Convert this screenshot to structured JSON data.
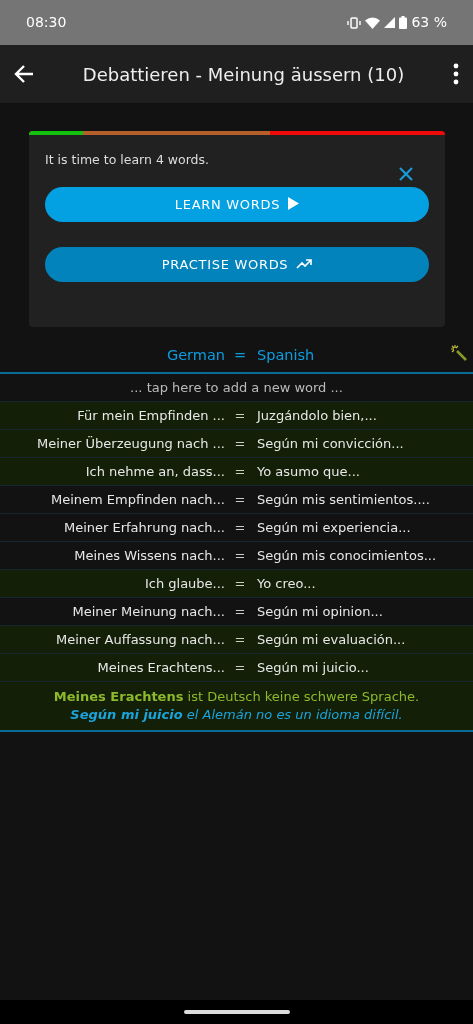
{
  "status_bar": {
    "time": "08:30",
    "battery": "63 %"
  },
  "app_bar": {
    "title": "Debattieren - Meinung äussern (10)"
  },
  "progress": {
    "color": "#f00a0a",
    "fills": [
      {
        "color": "#b5602a",
        "level": 0.58
      },
      {
        "color": "#13c10f",
        "level": 0.13
      }
    ]
  },
  "reminder": {
    "message": "It is time to learn 4 words.",
    "buttons": [
      {
        "label": "LEARN WORDS",
        "kind": "play"
      },
      {
        "label": "PRACTISE WORDS",
        "kind": "trend"
      }
    ]
  },
  "header": {
    "left": "German",
    "separator": "=",
    "right": "Spanish"
  },
  "add_hint": "... tap here to add a new word ...",
  "words": [
    {
      "left": "Für mein Empfinden ...",
      "sep": "=",
      "right": "Juzgándolo bien,...",
      "learned": true
    },
    {
      "left": "Meiner Überzeugung nach ...",
      "sep": "=",
      "right": "Según mi convicción...",
      "learned": true
    },
    {
      "left": "Ich nehme an, dass...",
      "sep": "=",
      "right": "Yo asumo que...",
      "learned": true
    },
    {
      "left": "Meinem Empfinden nach...",
      "sep": "=",
      "right": "Según mis sentimientos....",
      "learned": false
    },
    {
      "left": "Meiner Erfahrung nach...",
      "sep": "=",
      "right": "Según mi experiencia...",
      "learned": false
    },
    {
      "left": "Meines Wissens nach...",
      "sep": "=",
      "right": "Según mis conocimientos...",
      "learned": false
    },
    {
      "left": "Ich glaube...",
      "sep": "=",
      "right": "Yo creo...",
      "learned": true
    },
    {
      "left": "Meiner Meinung nach...",
      "sep": "=",
      "right": "Según mi opinion...",
      "learned": false
    },
    {
      "left": "Meiner Auffassung nach...",
      "sep": "=",
      "right": "Según mi evaluación...",
      "learned": true
    },
    {
      "left": "Meines Erachtens...",
      "sep": "=",
      "right": "Según mi juicio...",
      "learned": true
    }
  ],
  "example": {
    "left": "**Meines Erachtens** ist Deutsch keine schwere Sprache.",
    "right": "**Según mi juicio** el Alemán no es un idioma difícil.",
    "learned": true
  }
}
